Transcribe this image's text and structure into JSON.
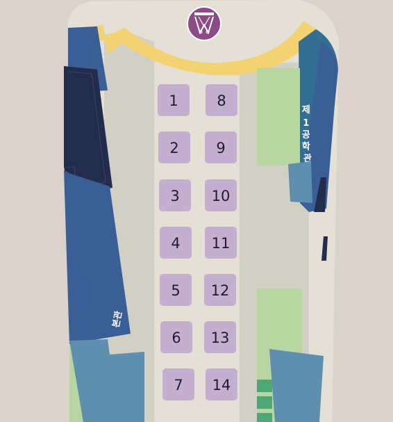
{
  "map": {
    "colors": {
      "background": "#dbd3cb",
      "campus_base": "#e5e0d6",
      "walkway": "#d2cfc5",
      "arc_path": "#f3d271",
      "booth": "#c4afd1",
      "booth_text": "#1f1c2c",
      "building_blue": "#3a5f97",
      "building_navy": "#232c4c",
      "building_teal": "#5e8fae",
      "building_steel": "#336f93",
      "lawn": "#b8d6a2",
      "green_steps": "#4ea874",
      "logo_bg": "#8a4b86"
    },
    "logo": {
      "icon": "university-emblem-icon"
    },
    "buildings": {
      "left_main": "본관",
      "right_engineering_lines": [
        "제",
        "1",
        "공",
        "학",
        "관"
      ]
    },
    "booths": [
      {
        "number": "1"
      },
      {
        "number": "2"
      },
      {
        "number": "3"
      },
      {
        "number": "4"
      },
      {
        "number": "5"
      },
      {
        "number": "6"
      },
      {
        "number": "7"
      },
      {
        "number": "8"
      },
      {
        "number": "9"
      },
      {
        "number": "10"
      },
      {
        "number": "11"
      },
      {
        "number": "12"
      },
      {
        "number": "13"
      },
      {
        "number": "14"
      }
    ]
  }
}
